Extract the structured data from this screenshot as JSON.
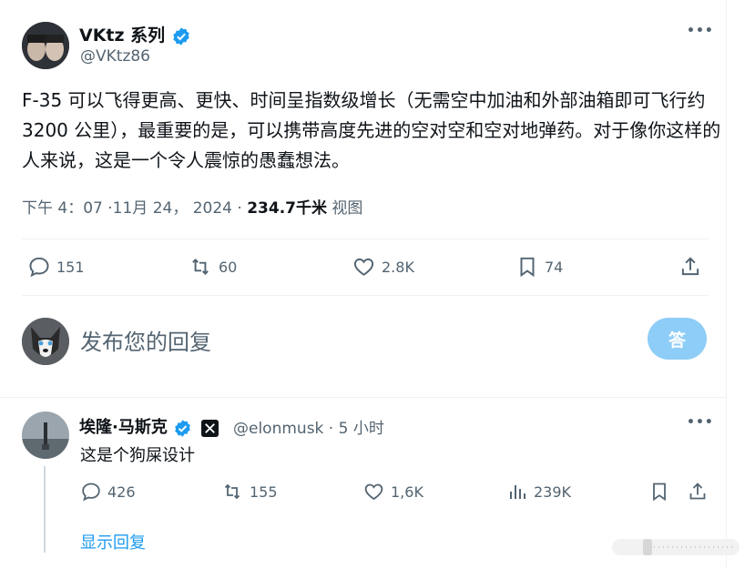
{
  "post": {
    "author_name": "VKtz 系列",
    "author_handle": "@VKtz86",
    "text": "F-35 可以飞得更高、更快、时间呈指数级增长（无需空中加油和外部油箱即可飞行约 3200 公里），最重要的是，可以携带高度先进的空对空和空对地弹药。对于像你这样的人来说，这是一个令人震惊的愚蠢想法。",
    "time": "下午 4：07 ·11月 24， 2024 ·",
    "views_count": "234.7千米",
    "views_label": "视图",
    "replies": "151",
    "reposts": "60",
    "likes": "2.8K",
    "bookmarks": "74",
    "more_label": "•••"
  },
  "composer": {
    "placeholder": "发布您的回复",
    "button_label": "答"
  },
  "reply": {
    "author_name": "埃隆·马斯克",
    "author_handle": "@elonmusk · 5 小时",
    "text": "这是个狗屎设计",
    "replies": "426",
    "reposts": "155",
    "likes": "1,6K",
    "views": "239K",
    "more_label": "•••",
    "show_replies": "显示回复"
  },
  "colors": {
    "verified": "#1d9bf0",
    "muted": "#536471",
    "link": "#1d9bf0",
    "reply_button": "#8ecdf7"
  }
}
